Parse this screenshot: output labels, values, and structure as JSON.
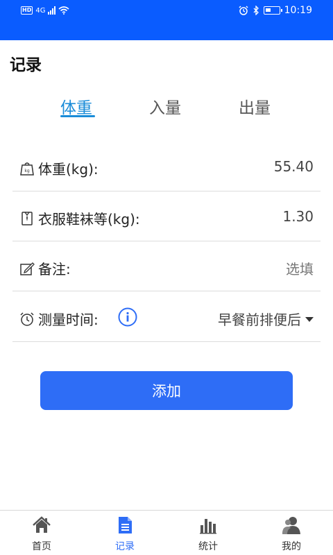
{
  "status_bar": {
    "hd": "HD",
    "network": "4G",
    "time": "10:19"
  },
  "page_title": "记录",
  "tabs": [
    {
      "label": "体重",
      "active": true
    },
    {
      "label": "入量",
      "active": false
    },
    {
      "label": "出量",
      "active": false
    }
  ],
  "form": {
    "weight": {
      "label": "体重(kg):",
      "value": "55.40",
      "icon": "scale-icon"
    },
    "clothes": {
      "label": "衣服鞋袜等(kg):",
      "value": "1.30",
      "icon": "shirt-icon"
    },
    "note": {
      "label": "备注:",
      "placeholder": "选填",
      "icon": "edit-icon"
    },
    "time": {
      "label": "测量时间:",
      "value": "早餐前排便后",
      "icon": "alarm-icon"
    }
  },
  "add_button": "添加",
  "tabbar": [
    {
      "label": "首页",
      "icon": "home-icon",
      "active": false
    },
    {
      "label": "记录",
      "icon": "document-icon",
      "active": true
    },
    {
      "label": "统计",
      "icon": "bar-chart-icon",
      "active": false
    },
    {
      "label": "我的",
      "icon": "user-icon",
      "active": false
    }
  ],
  "colors": {
    "status_bar": "#0a5cff",
    "accent": "#1a8cd8",
    "button": "#2e6df6"
  }
}
